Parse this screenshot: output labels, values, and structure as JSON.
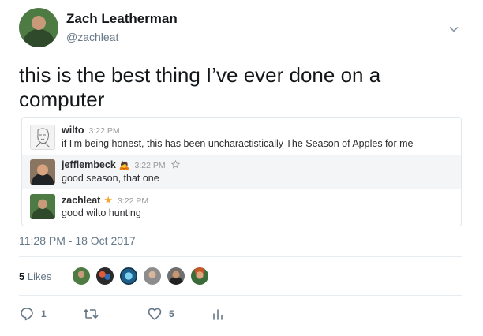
{
  "author": {
    "name": "Zach Leatherman",
    "handle": "@zachleat"
  },
  "tweet": {
    "text": "this is the best thing I’ve ever done on a computer",
    "timestamp": "11:28 PM - 18 Oct 2017"
  },
  "slack": {
    "messages": [
      {
        "user": "wilto",
        "time": "3:22 PM",
        "text": "if I'm being honest, this has been uncharactistically The Season of Apples for me",
        "badge": "",
        "highlighted": false
      },
      {
        "user": "jefflembeck",
        "time": "3:22 PM",
        "text": "good season, that one",
        "badge": "🙇",
        "highlighted": true
      },
      {
        "user": "zachleat",
        "time": "3:22 PM",
        "text": "good wilto hunting",
        "badge": "★",
        "highlighted": false
      }
    ]
  },
  "likes": {
    "count": "5",
    "label": "Likes"
  },
  "actions": {
    "replies": "1",
    "retweets": "",
    "likes": "5"
  },
  "colors": {
    "secondary_text": "#657786",
    "star": "#f4a52a",
    "divider": "#e6ecf0"
  }
}
